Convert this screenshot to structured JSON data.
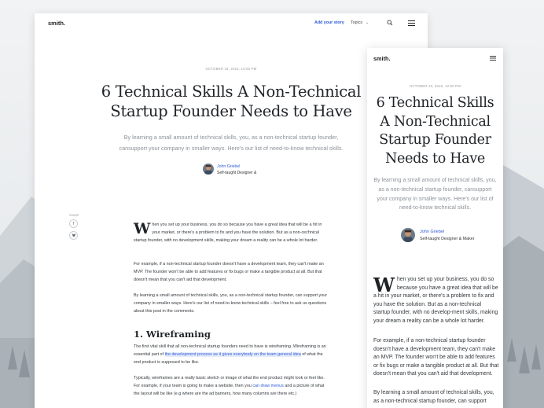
{
  "brand": "smith.",
  "nav": {
    "add_story": "Add your story",
    "topics": "Topics"
  },
  "icons": {
    "search": "search-icon",
    "menu": "hamburger-menu-icon",
    "chevron": "chevron-down-icon",
    "facebook": "facebook-icon",
    "twitter": "twitter-icon"
  },
  "colors": {
    "accent": "#2d5bd6",
    "title": "#1f2327",
    "subtitle": "#8d9298"
  },
  "article": {
    "date": "OCTOBER 19, 2016, 10:50 PM",
    "title": "6 Technical Skills A Non-Technical Startup Founder Needs to Have",
    "subtitle": "By learning a small amount of technical skills, you, as a non-technical startup founder, cansupport your company in smaller ways. Here's our list of need-to-know technical skills.",
    "author_name": "John Griebel",
    "author_role_desktop": "Self-taught Designer &",
    "author_role_mobile": "Self-taught Designer & Maker",
    "share_label": "SHARE",
    "p1_dropcap": "W",
    "p1_rest": "hen you set up your business, you do so because you have a great idea that will be a hit in your market, or there's a problem to fix and you have the solution. But as a non-cechnical startup founder, with no development skills, making your dream a reality can be a whole lot harder.",
    "p2": "For example, if a non-technical startup founder doesn't have a development team, they can't make an MVP. The founder won't be able to add features or fix bugs or make a tangible product at all. But that doesn't mean that you can't aid that development.",
    "p3": "By learning a small amount of technical skills, you, as a non-technical startup founder, can support your company in smaller ways. Here's our list of need-to-know technical skills – feel free to ask us questions about this post in the comments.",
    "h2": "1. Wireframing",
    "p4_a": "The first vital skill that all non-technical startup founders need to have is wireframing. Wireframing is an essential part of ",
    "p4_link": "the development process as it gives everybody on the team general idea",
    "p4_b": " of what the end product is supposed to be like.",
    "p5_a": "Typically, wireframes are a really basic sketch or image of what the end product might look or feel like. For example, if your team is going to make a website, then you ",
    "p5_link": "can draw menus",
    "p5_b": " and a picture of what the layout will be like (e.g where are the ad banners, how many columns are there etc.)"
  },
  "mobile": {
    "date": "OCTOBER 19, 2016, 10:50 PM",
    "subtitle": "By learning a small amount of technical skills, you, as a non-technical startup founder, cansupport your company in smaller ways. Here's our list of need-to-know technical skills.",
    "p1_rest": "hen you set up your business, you do so because you have a great idea that will be a hit in your market, or there's a problem to fix and you have the solution. But as a non-technical startup founder, with no develop-ment skills, making your dream a reality can be a whole lot harder.",
    "p2": "For example, if a non-technical startup founder doesn't have a development team, they can't make an MVP. The founder won't be able to add features or fix bugs or make a tangible product at all. But that doesn't mean that you can't aid that development.",
    "p3": "By learning a small amount of technical skills, you, as a non-technical startup founder, can support"
  }
}
